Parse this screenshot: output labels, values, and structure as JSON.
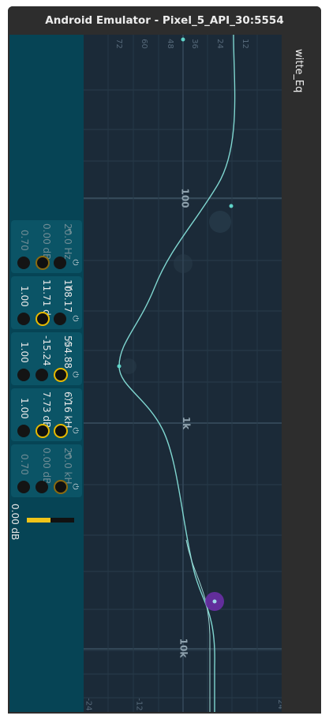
{
  "window": {
    "title": "Android Emulator - Pixel_5_API_30:5554"
  },
  "app": {
    "title": "witte_Eq"
  },
  "graph": {
    "freq_labels": [
      "100",
      "1k",
      "10k"
    ],
    "gain_top_labels": [
      "72",
      "60",
      "48",
      "36",
      "24",
      "12"
    ],
    "gain_bottom_labels": [
      "-24",
      "-12",
      "0",
      "12",
      "24"
    ]
  },
  "bands": [
    {
      "shape": "low-shelf",
      "shape_glyph": "⌐",
      "freq": "20.0 Hz",
      "gain": "0.00 dB",
      "q": "0.70",
      "enabled": false
    },
    {
      "shape": "peak",
      "shape_glyph": "Y",
      "freq": "108.17",
      "gain": "11.71 d",
      "q": "1.00",
      "enabled": true
    },
    {
      "shape": "notch",
      "shape_glyph": "◇",
      "freq": "554.88",
      "gain": "-15.24",
      "q": "1.00",
      "enabled": true
    },
    {
      "shape": "peak",
      "shape_glyph": "Y",
      "freq": "6.16 kH",
      "gain": "7.73 dB",
      "q": "1.00",
      "enabled": true
    },
    {
      "shape": "high-shelf",
      "shape_glyph": "⌐",
      "freq": "20.0 kH",
      "gain": "0.00 dB",
      "q": "0.70",
      "enabled": false
    }
  ],
  "output": {
    "gain": "0.00 dB",
    "level": 0.5
  },
  "colors": {
    "accent": "#e6b800",
    "curve": "#7fd6d0",
    "selected_node": "#8a3cc8"
  }
}
